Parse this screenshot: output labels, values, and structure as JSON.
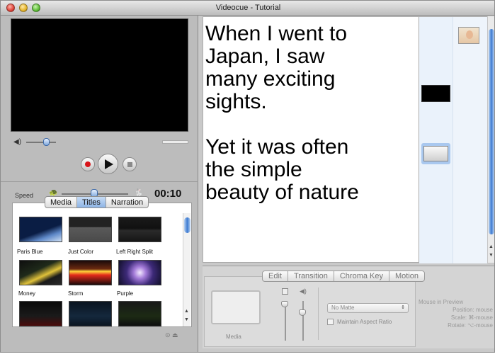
{
  "window": {
    "title": "Videocue - Tutorial"
  },
  "player": {
    "speed_label": "Speed",
    "time": "00:10"
  },
  "media_tabs": [
    "Media",
    "Titles",
    "Narration"
  ],
  "title_tiles": [
    {
      "label": "Paris Blue"
    },
    {
      "label": "Just Color"
    },
    {
      "label": "Left Right Split"
    },
    {
      "label": "Money"
    },
    {
      "label": "Storm"
    },
    {
      "label": "Purple"
    }
  ],
  "script_text": {
    "lines_a": [
      "When I went to",
      "Japan, I saw",
      "many exciting",
      "sights."
    ],
    "lines_b": [
      "Yet it was often",
      "the simple",
      "beauty of nature"
    ]
  },
  "inspector": {
    "tabs": [
      "Edit",
      "Transition",
      "Chroma Key",
      "Motion"
    ],
    "media_label": "Media",
    "matte_value": "No Matte",
    "maintain_aspect_label": "Maintain Aspect Ratio",
    "help_title": "Mouse in Preview",
    "help_lines": [
      "Position: mouse",
      "Scale: ⌘-mouse",
      "Rotate: ⌥-mouse"
    ]
  },
  "icons": {
    "volume": "speaker-icon",
    "slow": "turtle-icon",
    "fast": "rabbit-icon"
  },
  "colors": {
    "accent": "#3d7ad1",
    "record": "#d8141a"
  }
}
